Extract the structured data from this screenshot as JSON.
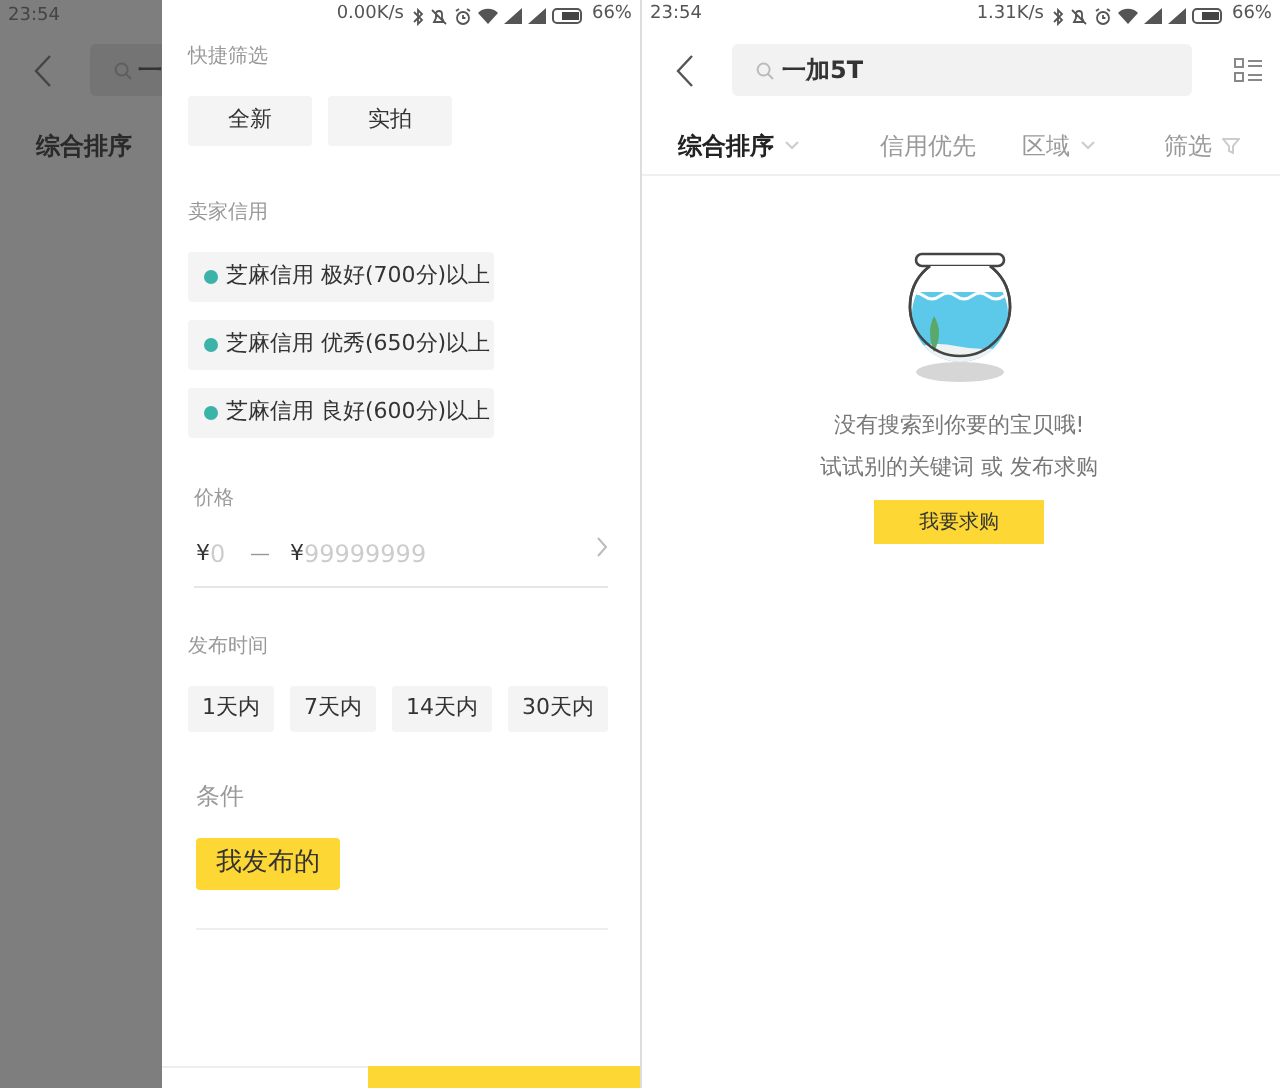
{
  "left_screen": {
    "status_bar": {
      "time": "23:54",
      "speed": "0.00K/s",
      "battery": "66%"
    },
    "background": {
      "search_text": "一",
      "sort_label": "综合排序"
    },
    "filter_drawer": {
      "quick_filter": {
        "title": "快捷筛选",
        "options": [
          {
            "label": "全新",
            "selected": false
          },
          {
            "label": "实拍",
            "selected": false
          }
        ]
      },
      "seller_credit": {
        "title": "卖家信用",
        "options": [
          {
            "label": "芝麻信用 极好(700分)以上",
            "selected": false
          },
          {
            "label": "芝麻信用 优秀(650分)以上",
            "selected": false
          },
          {
            "label": "芝麻信用 良好(600分)以上",
            "selected": false
          }
        ]
      },
      "price": {
        "title": "价格",
        "currency_min": "¥",
        "min_placeholder": "0",
        "separator": "—",
        "currency_max": "¥",
        "max_placeholder": "99999999"
      },
      "publish_time": {
        "title": "发布时间",
        "options": [
          {
            "label": "1天内",
            "selected": false
          },
          {
            "label": "7天内",
            "selected": false
          },
          {
            "label": "14天内",
            "selected": false
          },
          {
            "label": "30天内",
            "selected": false
          }
        ]
      },
      "condition": {
        "title": "条件",
        "options": [
          {
            "label": "我发布的",
            "selected": true
          }
        ]
      }
    }
  },
  "right_screen": {
    "status_bar": {
      "time": "23:54",
      "speed": "1.31K/s",
      "battery": "66%"
    },
    "search": {
      "value": "一加5T"
    },
    "sort_tabs": [
      {
        "label": "综合排序",
        "selected": true,
        "kind": "dropdown"
      },
      {
        "label": "信用优先",
        "selected": false,
        "kind": "plain"
      },
      {
        "label": "区域",
        "selected": false,
        "kind": "dropdown"
      },
      {
        "label": "筛选",
        "selected": false,
        "kind": "filter"
      }
    ],
    "empty_state": {
      "lines": [
        "没有搜索到你要的宝贝哦!",
        "试试别的关键词 或 发布求购"
      ],
      "button": "我要求购"
    }
  }
}
